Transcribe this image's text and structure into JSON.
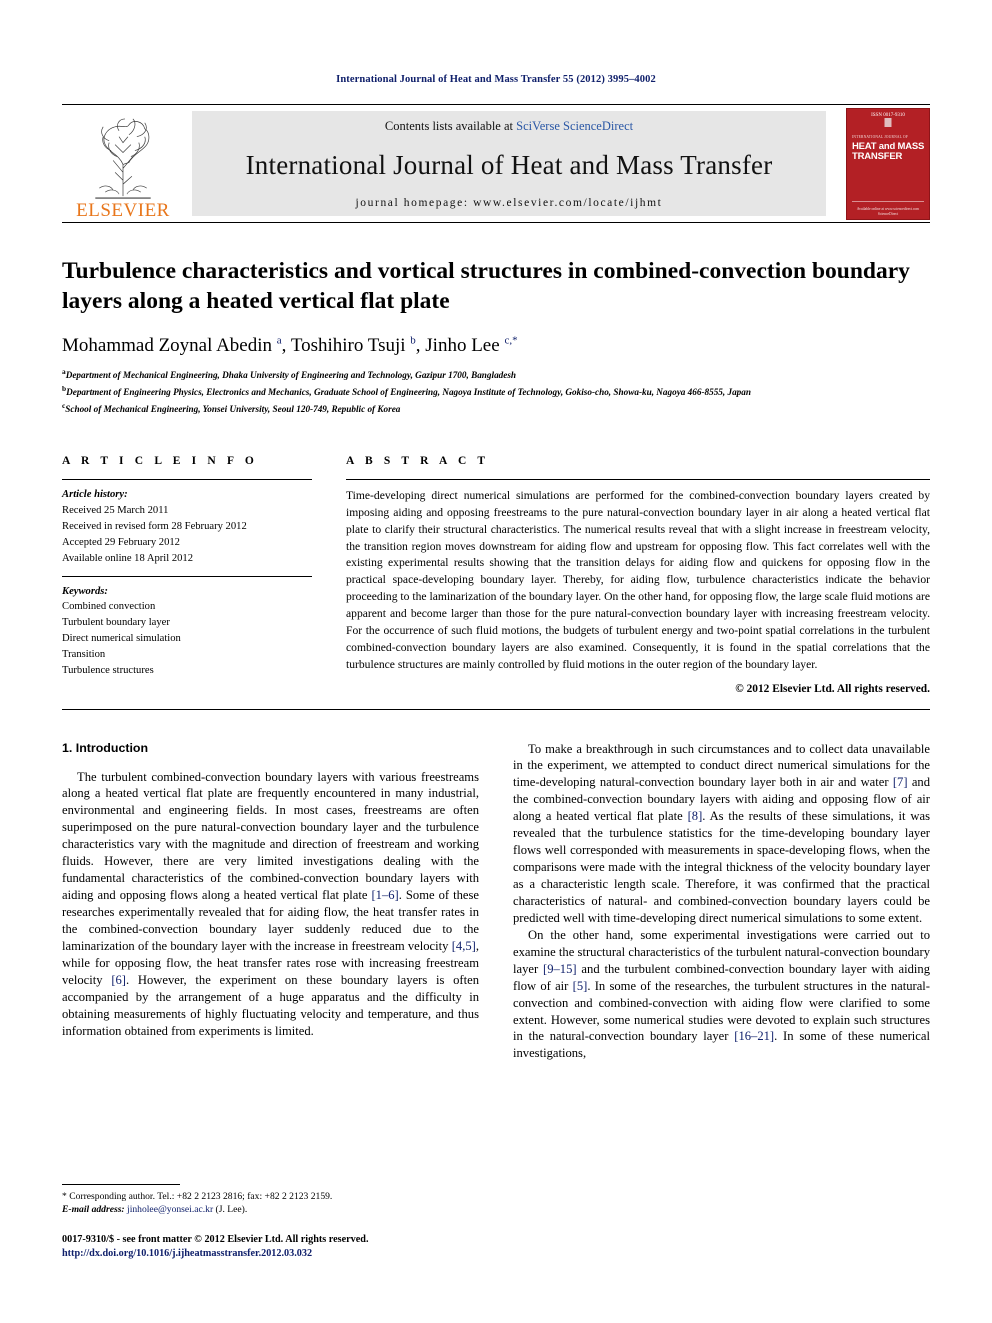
{
  "running_head": "International Journal of Heat and Mass Transfer 55 (2012) 3995–4002",
  "masthead": {
    "publisher": "ELSEVIER",
    "contents_prefix": "Contents lists available at ",
    "contents_link": "SciVerse ScienceDirect",
    "journal_name": "International Journal of Heat and Mass Transfer",
    "homepage": "journal homepage: www.elsevier.com/locate/ijhmt",
    "cover": {
      "top_label": "ISSN 0017-9310",
      "sub_label": "INTERNATIONAL JOURNAL OF",
      "title_line1": "HEAT and MASS",
      "title_line2": "TRANSFER",
      "foot_line1": "Available online at www.sciencedirect.com",
      "foot_line2": "ScienceDirect"
    }
  },
  "article": {
    "title": "Turbulence characteristics and vortical structures in combined-convection boundary layers along a heated vertical flat plate",
    "authors_html": "Mohammad Zoynal Abedin <sup>a</sup>, Toshihiro Tsuji <sup>b</sup>, Jinho Lee <sup>c,</sup><sup>*</sup>",
    "affiliations": [
      {
        "marker": "a",
        "text": "Department of Mechanical Engineering, Dhaka University of Engineering and Technology, Gazipur 1700, Bangladesh"
      },
      {
        "marker": "b",
        "text": "Department of Engineering Physics, Electronics and Mechanics, Graduate School of Engineering, Nagoya Institute of Technology, Gokiso-cho, Showa-ku, Nagoya 466-8555, Japan"
      },
      {
        "marker": "c",
        "text": "School of Mechanical Engineering, Yonsei University, Seoul 120-749, Republic of Korea"
      }
    ]
  },
  "article_info": {
    "label": "A R T I C L E  I N F O",
    "history_label": "Article history:",
    "history": [
      "Received 25 March 2011",
      "Received in revised form 28 February 2012",
      "Accepted 29 February 2012",
      "Available online 18 April 2012"
    ],
    "keywords_label": "Keywords:",
    "keywords": [
      "Combined convection",
      "Turbulent boundary layer",
      "Direct numerical simulation",
      "Transition",
      "Turbulence structures"
    ]
  },
  "abstract": {
    "label": "A B S T R A C T",
    "text": "Time-developing direct numerical simulations are performed for the combined-convection boundary layers created by imposing aiding and opposing freestreams to the pure natural-convection boundary layer in air along a heated vertical flat plate to clarify their structural characteristics. The numerical results reveal that with a slight increase in freestream velocity, the transition region moves downstream for aiding flow and upstream for opposing flow. This fact correlates well with the existing experimental results showing that the transition delays for aiding flow and quickens for opposing flow in the practical space-developing boundary layer. Thereby, for aiding flow, turbulence characteristics indicate the behavior proceeding to the laminarization of the boundary layer. On the other hand, for opposing flow, the large scale fluid motions are apparent and become larger than those for the pure natural-convection boundary layer with increasing freestream velocity. For the occurrence of such fluid motions, the budgets of turbulent energy and two-point spatial correlations in the turbulent combined-convection boundary layers are also examined. Consequently, it is found in the spatial correlations that the turbulence structures are mainly controlled by fluid motions in the outer region of the boundary layer.",
    "copyright": "© 2012 Elsevier Ltd. All rights reserved."
  },
  "introduction": {
    "heading": "1. Introduction",
    "left_paragraphs": [
      "The turbulent combined-convection boundary layers with various freestreams along a heated vertical flat plate are frequently encountered in many industrial, environmental and engineering fields. In most cases, freestreams are often superimposed on the pure natural-convection boundary layer and the turbulence characteristics vary with the magnitude and direction of freestream and working fluids. However, there are very limited investigations dealing with the fundamental characteristics of the combined-convection boundary layers with aiding and opposing flows along a heated vertical flat plate [1–6]. Some of these researches experimentally revealed that for aiding flow, the heat transfer rates in the combined-convection boundary layer suddenly reduced due to the laminarization of the boundary layer with the increase in freestream velocity [4,5], while for opposing flow, the heat transfer rates rose with increasing freestream velocity [6]. However, the experiment on these boundary layers is often accompanied by the arrangement of a huge apparatus and the difficulty in obtaining measurements of highly fluctuating velocity and temperature, and thus information obtained from experiments is limited."
    ],
    "right_paragraphs": [
      "To make a breakthrough in such circumstances and to collect data unavailable in the experiment, we attempted to conduct direct numerical simulations for the time-developing natural-convection boundary layer both in air and water [7] and the combined-convection boundary layers with aiding and opposing flow of air along a heated vertical flat plate [8]. As the results of these simulations, it was revealed that the turbulence statistics for the time-developing boundary layer flows well corresponded with measurements in space-developing flows, when the comparisons were made with the integral thickness of the velocity boundary layer as a characteristic length scale. Therefore, it was confirmed that the practical characteristics of natural- and combined-convection boundary layers could be predicted well with time-developing direct numerical simulations to some extent.",
      "On the other hand, some experimental investigations were carried out to examine the structural characteristics of the turbulent natural-convection boundary layer [9–15] and the turbulent combined-convection boundary layer with aiding flow of air [5]. In some of the researches, the turbulent structures in the natural-convection and combined-convection with aiding flow were clarified to some extent. However, some numerical studies were devoted to explain such structures in the natural-convection boundary layer [16–21]. In some of these numerical investigations,"
    ]
  },
  "footnote": {
    "corresponding": "* Corresponding author. Tel.: +82 2 2123 2816; fax: +82 2 2123 2159.",
    "email_label": "E-mail address:",
    "email": "jinholee@yonsei.ac.kr",
    "email_suffix": "(J. Lee).",
    "issn_line": "0017-9310/$ - see front matter © 2012 Elsevier Ltd. All rights reserved.",
    "doi": "http://dx.doi.org/10.1016/j.ijheatmasstransfer.2012.03.032"
  },
  "colors": {
    "link": "#2a57a5",
    "ref": "#10206b",
    "elsevier_orange": "#e8761b",
    "cover_red": "#b32025",
    "banner_gray": "#e6e6e6"
  }
}
